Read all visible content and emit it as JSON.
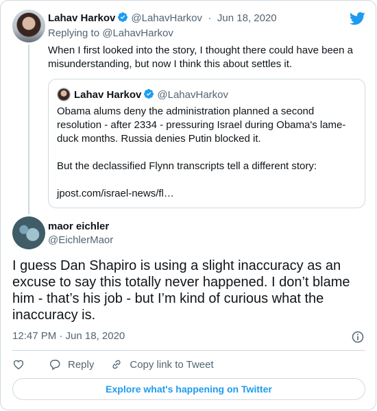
{
  "reply_tweet": {
    "author_name": "Lahav Harkov",
    "handle": "@LahavHarkov",
    "separator": "·",
    "date": "Jun 18, 2020",
    "replying_to": "Replying to @LahavHarkov",
    "text": "When I first looked into the story, I thought there could have been a misunderstanding, but now I think this about settles it."
  },
  "quoted_tweet": {
    "author_name": "Lahav Harkov",
    "handle": "@LahavHarkov",
    "paragraphs": [
      "Obama alums deny the administration planned a second resolution - after 2334 - pressuring Israel during Obama's lame-duck months. Russia denies Putin blocked it.",
      "But the declassified Flynn transcripts tell a different story:",
      "jpost.com/israel-news/fl…"
    ]
  },
  "main_tweet": {
    "author_name": "maor eichler",
    "handle": "@EichlerMaor",
    "text": "I guess Dan Shapiro is using a slight inaccuracy as an excuse to say this totally never happened. I don’t blame him - that’s his job - but I’m kind of curious what the inaccuracy is.",
    "timestamp": "12:47 PM · Jun 18, 2020"
  },
  "actions": {
    "like_icon": "heart-icon",
    "reply_label": "Reply",
    "copy_link_label": "Copy link to Tweet"
  },
  "explore_label": "Explore what's happening on Twitter",
  "colors": {
    "accent": "#1d9bf0",
    "text": "#0f1419",
    "muted": "#536471",
    "border": "#cfd9de"
  }
}
